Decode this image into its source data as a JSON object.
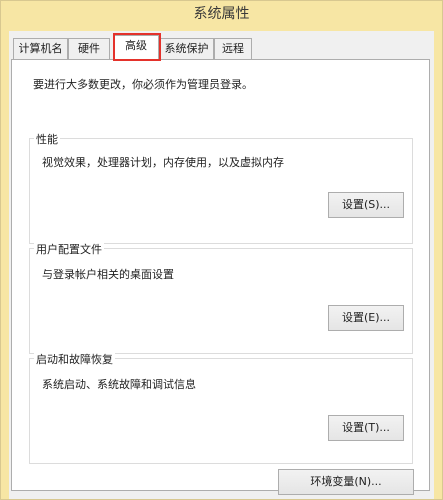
{
  "window": {
    "title": "系统属性"
  },
  "tabs": [
    {
      "label": "计算机名"
    },
    {
      "label": "硬件"
    },
    {
      "label": "高级"
    },
    {
      "label": "系统保护"
    },
    {
      "label": "远程"
    }
  ],
  "advanced": {
    "notice": "要进行大多数更改，你必须作为管理员登录。",
    "performance": {
      "title": "性能",
      "description": "视觉效果，处理器计划，内存使用，以及虚拟内存",
      "button": "设置(S)..."
    },
    "user_profiles": {
      "title": "用户配置文件",
      "description": "与登录帐户相关的桌面设置",
      "button": "设置(E)..."
    },
    "startup_recovery": {
      "title": "启动和故障恢复",
      "description": "系统启动、系统故障和调试信息",
      "button": "设置(T)..."
    },
    "env_button": "环境变量(N)..."
  },
  "colors": {
    "titlebar": "#f7e6a4",
    "highlight": "#e4322b"
  }
}
